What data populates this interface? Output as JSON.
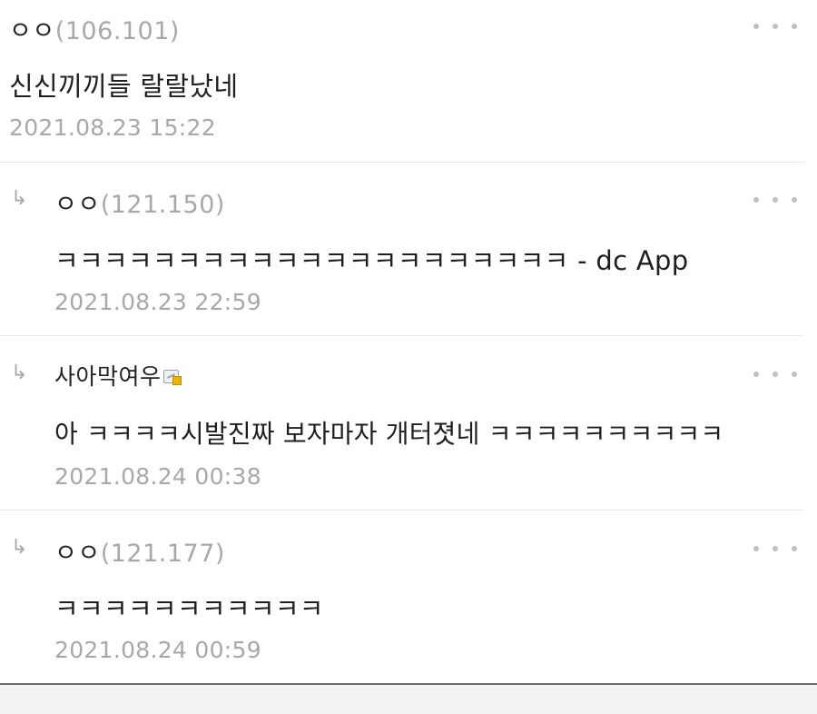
{
  "comments": [
    {
      "nick": "ㅇㅇ",
      "ip": "(106.101)",
      "text": "신신끼끼들 랄랄났네",
      "date": "2021.08.23 15:22"
    },
    {
      "nick": "ㅇㅇ",
      "ip": "(121.150)",
      "text": "ㅋㅋㅋㅋㅋㅋㅋㅋㅋㅋㅋㅋㅋㅋㅋㅋㅋㅋㅋㅋㅋ - dc App",
      "date": "2021.08.23 22:59",
      "reply_icon": "↳"
    },
    {
      "nick": "사아막여우",
      "ip": "",
      "text": "아 ㅋㅋㅋㅋ시발진짜 보자마자 개터졋네 ㅋㅋㅋㅋㅋㅋㅋㅋㅋㅋ",
      "date": "2021.08.24 00:38",
      "reply_icon": "↳",
      "badge_icon": "gallog-fixed-nick-icon"
    },
    {
      "nick": "ㅇㅇ",
      "ip": "(121.177)",
      "text": "ㅋㅋㅋㅋㅋㅋㅋㅋㅋㅋㅋ",
      "date": "2021.08.24 00:59",
      "reply_icon": "↳"
    }
  ],
  "icons": {
    "more": "more-options-icon",
    "reply": "reply-arrow-icon"
  },
  "colors": {
    "ip": "#a8a8a8",
    "date": "#a8a8a8",
    "separator": "#e8e8e8",
    "bottom_bar_border": "#6b6b6b"
  }
}
